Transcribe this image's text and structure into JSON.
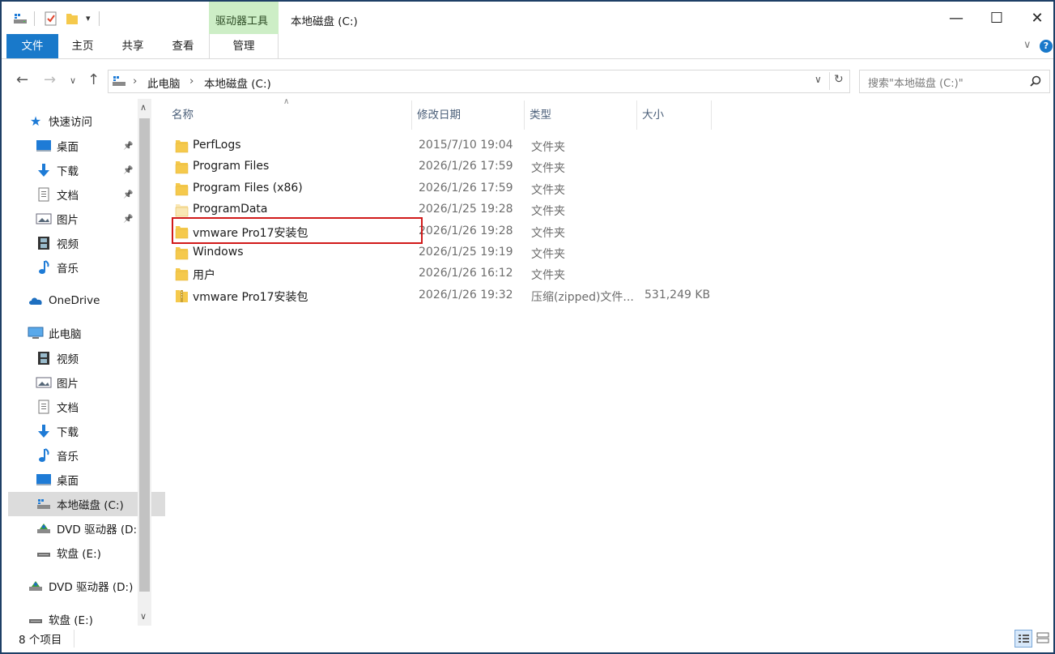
{
  "window": {
    "title": "本地磁盘 (C:)",
    "context_tab_group": "驱动器工具",
    "buttons": {
      "minimize": "—",
      "maximize": "☐",
      "close": "✕"
    }
  },
  "ribbon": {
    "tabs": [
      {
        "label": "文件"
      },
      {
        "label": "主页"
      },
      {
        "label": "共享"
      },
      {
        "label": "查看"
      },
      {
        "label": "管理"
      }
    ],
    "expand_icon": "chevron-down",
    "help_glyph": "?"
  },
  "address": {
    "breadcrumb": [
      "此电脑",
      "本地磁盘 (C:)"
    ],
    "search_placeholder": "搜索\"本地磁盘 (C:)\""
  },
  "nav": {
    "quick_access": "快速访问",
    "quick_items": [
      {
        "label": "桌面",
        "icon": "desktop-icon",
        "pinned": true
      },
      {
        "label": "下载",
        "icon": "download-icon",
        "pinned": true
      },
      {
        "label": "文档",
        "icon": "document-icon",
        "pinned": true
      },
      {
        "label": "图片",
        "icon": "pictures-icon",
        "pinned": true
      },
      {
        "label": "视频",
        "icon": "video-icon",
        "pinned": false
      },
      {
        "label": "音乐",
        "icon": "music-icon",
        "pinned": false
      }
    ],
    "onedrive": "OneDrive",
    "this_pc": "此电脑",
    "pc_items": [
      {
        "label": "视频",
        "icon": "video-icon"
      },
      {
        "label": "图片",
        "icon": "pictures-icon"
      },
      {
        "label": "文档",
        "icon": "document-icon"
      },
      {
        "label": "下载",
        "icon": "download-icon"
      },
      {
        "label": "音乐",
        "icon": "music-icon"
      },
      {
        "label": "桌面",
        "icon": "desktop-icon"
      },
      {
        "label": "本地磁盘 (C:)",
        "icon": "drive-icon",
        "selected": true
      },
      {
        "label": "DVD 驱动器 (D:",
        "icon": "dvd-icon"
      },
      {
        "label": "软盘 (E:)",
        "icon": "floppy-icon"
      }
    ],
    "dvd": "DVD 驱动器 (D:)",
    "floppy": "软盘 (E:)"
  },
  "columns": {
    "name": "名称",
    "date": "修改日期",
    "type": "类型",
    "size": "大小"
  },
  "files": [
    {
      "name": "PerfLogs",
      "date": "2015/7/10 19:04",
      "type": "文件夹",
      "size": "",
      "kind": "folder"
    },
    {
      "name": "Program Files",
      "date": "2026/1/26 17:59",
      "type": "文件夹",
      "size": "",
      "kind": "folder"
    },
    {
      "name": "Program Files (x86)",
      "date": "2026/1/26 17:59",
      "type": "文件夹",
      "size": "",
      "kind": "folder"
    },
    {
      "name": "ProgramData",
      "date": "2026/1/25 19:28",
      "type": "文件夹",
      "size": "",
      "kind": "folder-hidden"
    },
    {
      "name": "vmware Pro17安装包",
      "date": "2026/1/26 19:28",
      "type": "文件夹",
      "size": "",
      "kind": "folder",
      "highlighted": true
    },
    {
      "name": "Windows",
      "date": "2026/1/25 19:19",
      "type": "文件夹",
      "size": "",
      "kind": "folder"
    },
    {
      "name": "用户",
      "date": "2026/1/26 16:12",
      "type": "文件夹",
      "size": "",
      "kind": "folder"
    },
    {
      "name": "vmware Pro17安装包",
      "date": "2026/1/26 19:32",
      "type": "压缩(zipped)文件...",
      "size": "531,249 KB",
      "kind": "zip"
    }
  ],
  "status": {
    "count": "8 个项目"
  },
  "colors": {
    "accent": "#1979ca",
    "context_tab": "#cdeec6",
    "highlight_border": "#d11a1a",
    "folder": "#f5c94c"
  }
}
